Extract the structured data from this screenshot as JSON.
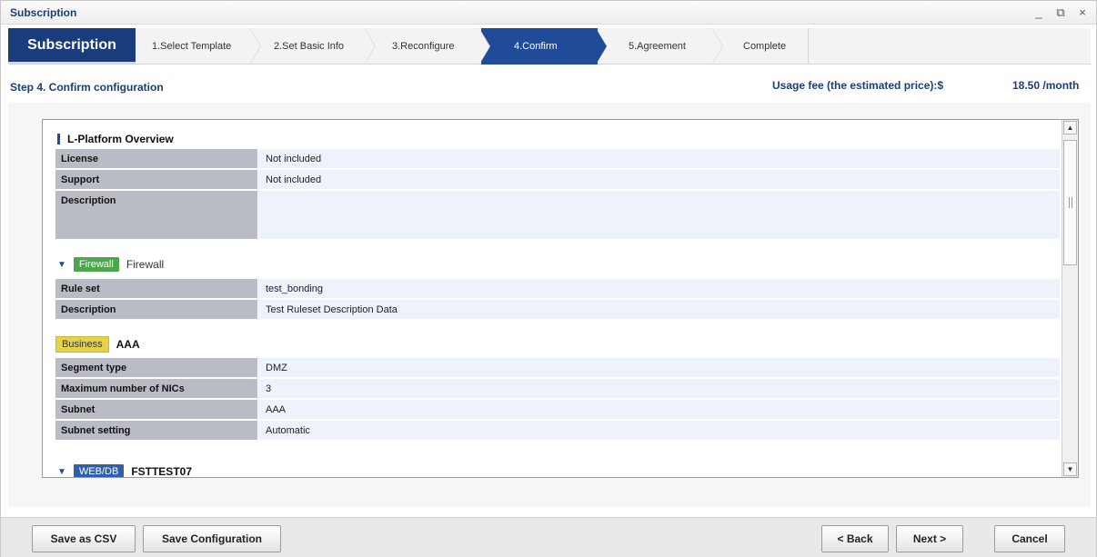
{
  "window": {
    "title": "Subscription",
    "minimize_glyph": "_",
    "restore_glyph": "⧉",
    "close_glyph": "×"
  },
  "wizard": {
    "main_label": "Subscription",
    "steps": [
      {
        "label": "1.Select Template",
        "active": false
      },
      {
        "label": "2.Set Basic Info",
        "active": false
      },
      {
        "label": "3.Reconfigure",
        "active": false
      },
      {
        "label": "4.Confirm",
        "active": true
      },
      {
        "label": "5.Agreement",
        "active": false
      },
      {
        "label": "Complete",
        "active": false
      }
    ]
  },
  "header": {
    "step_title": "Step 4. Confirm configuration",
    "fee_label": "Usage fee (the estimated price):$",
    "fee_amount": "18.50 /month"
  },
  "sections": {
    "overview": {
      "title": "L-Platform Overview",
      "rows": [
        {
          "label": "License",
          "value": "Not included"
        },
        {
          "label": "Support",
          "value": "Not included"
        },
        {
          "label": "Description",
          "value": ""
        }
      ]
    },
    "firewall": {
      "tag": "Firewall",
      "name": "Firewall",
      "rows": [
        {
          "label": "Rule set",
          "value": "test_bonding"
        },
        {
          "label": "Description",
          "value": "Test Ruleset Description Data"
        }
      ]
    },
    "business": {
      "tag": "Business",
      "name": "AAA",
      "rows": [
        {
          "label": "Segment type",
          "value": "DMZ"
        },
        {
          "label": "Maximum number of NICs",
          "value": "3"
        },
        {
          "label": "Subnet",
          "value": "AAA"
        },
        {
          "label": "Subnet setting",
          "value": "Automatic"
        }
      ]
    },
    "webdb": {
      "tag": "WEB/DB",
      "name": "FSTTEST07"
    }
  },
  "footer": {
    "save_csv": "Save as CSV",
    "save_config": "Save Configuration",
    "back": "< Back",
    "next": "Next >",
    "cancel": "Cancel"
  }
}
